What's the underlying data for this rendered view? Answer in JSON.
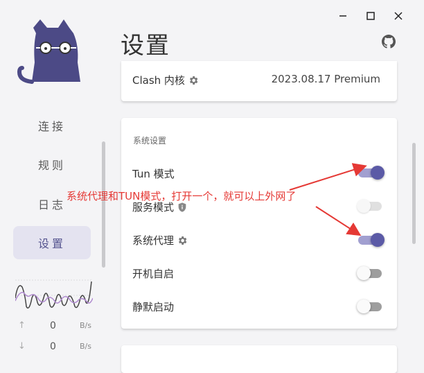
{
  "window": {
    "controls": [
      "minimize",
      "maximize",
      "close"
    ]
  },
  "sidebar": {
    "items": [
      {
        "label": "连接",
        "active": false
      },
      {
        "label": "规则",
        "active": false
      },
      {
        "label": "日志",
        "active": false
      },
      {
        "label": "设置",
        "active": true
      }
    ],
    "traffic": {
      "upload": {
        "value": "0",
        "unit": "B/s",
        "icon": "arrow-up-icon"
      },
      "download": {
        "value": "0",
        "unit": "B/s",
        "icon": "arrow-down-icon"
      }
    }
  },
  "header": {
    "title": "设置",
    "github_icon": "github-icon"
  },
  "clash_card": {
    "label": "Clash 内核",
    "value": "2023.08.17 Premium"
  },
  "system_card": {
    "title": "系统设置",
    "rows": [
      {
        "label": "Tun 模式",
        "enabled": true,
        "icon": null
      },
      {
        "label": "服务模式",
        "enabled": false,
        "icon": "shield-icon"
      },
      {
        "label": "系统代理",
        "enabled": true,
        "icon": "gear-icon"
      },
      {
        "label": "开机自启",
        "enabled": false,
        "icon": null
      },
      {
        "label": "静默启动",
        "enabled": false,
        "icon": null
      }
    ]
  },
  "annotation": {
    "text": "系统代理和TUN模式，打开一个，就可以上外网了"
  },
  "colors": {
    "accent": "#5b5aa6",
    "annotation": "#e53935"
  }
}
